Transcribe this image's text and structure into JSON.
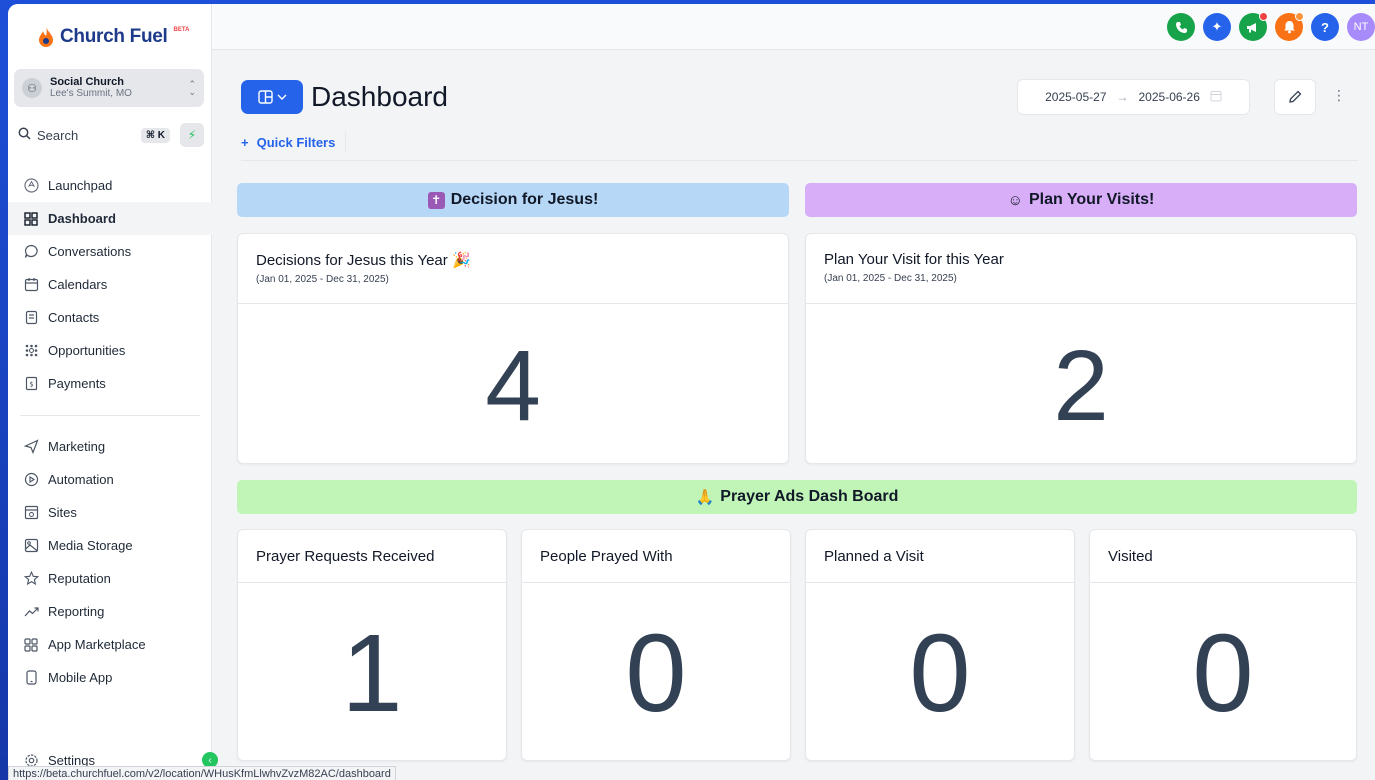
{
  "brand": {
    "name": "Church Fuel",
    "beta": "BETA"
  },
  "account": {
    "name": "Social Church",
    "location": "Lee's Summit, MO"
  },
  "search": {
    "label": "Search",
    "shortcut": "⌘ K"
  },
  "nav": {
    "items": [
      {
        "label": "Launchpad",
        "icon": "rocket-icon"
      },
      {
        "label": "Dashboard",
        "icon": "grid-icon"
      },
      {
        "label": "Conversations",
        "icon": "chat-icon"
      },
      {
        "label": "Calendars",
        "icon": "calendar-icon"
      },
      {
        "label": "Contacts",
        "icon": "contacts-icon"
      },
      {
        "label": "Opportunities",
        "icon": "opportunities-icon"
      },
      {
        "label": "Payments",
        "icon": "payments-icon"
      }
    ],
    "items2": [
      {
        "label": "Marketing",
        "icon": "send-icon"
      },
      {
        "label": "Automation",
        "icon": "automation-icon"
      },
      {
        "label": "Sites",
        "icon": "sites-icon"
      },
      {
        "label": "Media Storage",
        "icon": "image-icon"
      },
      {
        "label": "Reputation",
        "icon": "star-icon"
      },
      {
        "label": "Reporting",
        "icon": "trend-icon"
      },
      {
        "label": "App Marketplace",
        "icon": "apps-icon"
      },
      {
        "label": "Mobile App",
        "icon": "mobile-icon"
      }
    ],
    "settings": "Settings"
  },
  "status_url": "https://beta.churchfuel.com/v2/location/WHusKfmLlwhvZvzM82AC/dashboard",
  "header": {
    "avatar_initials": "NT",
    "icon_colors": {
      "phone": "#16a34a",
      "ai": "#2563eb",
      "announce": "#16a34a",
      "bell": "#f97316",
      "help": "#2563eb",
      "avatar": "#a78bfa"
    }
  },
  "page": {
    "title": "Dashboard",
    "date_start": "2025-05-27",
    "date_end": "2025-06-26",
    "quick_filters": "Quick Filters"
  },
  "sections": {
    "decision": {
      "title": "Decision for Jesus!",
      "color": "#b6d8f6"
    },
    "visits": {
      "title": "Plan Your Visits!",
      "color": "#d7aef7"
    },
    "prayer": {
      "title": "Prayer Ads Dash Board",
      "color": "#c1f5b8"
    }
  },
  "cards": {
    "decisions": {
      "title": "Decisions for Jesus this Year",
      "range": "(Jan 01, 2025 - Dec 31, 2025)",
      "value": "4"
    },
    "visits": {
      "title": "Plan Your Visit for this Year",
      "range": "(Jan 01, 2025 - Dec 31, 2025)",
      "value": "2"
    },
    "prayer_requests": {
      "title": "Prayer Requests Received",
      "value": "1"
    },
    "prayed_with": {
      "title": "People Prayed With",
      "value": "0"
    },
    "planned_visit": {
      "title": "Planned a Visit",
      "value": "0"
    },
    "visited": {
      "title": "Visited",
      "value": "0"
    }
  }
}
